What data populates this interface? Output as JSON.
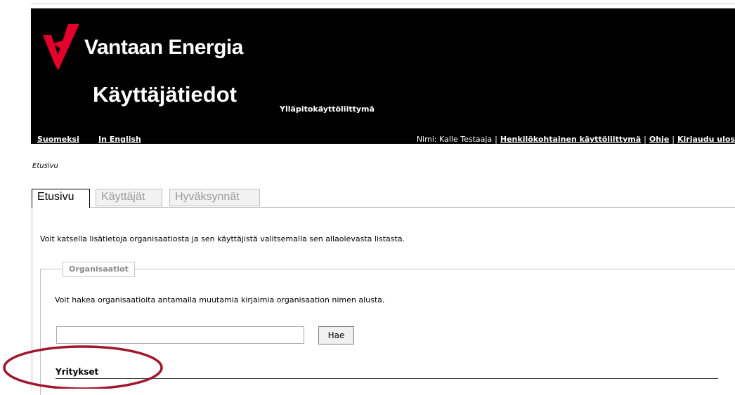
{
  "header": {
    "brand": "Vantaan Energia",
    "app_title": "Käyttäjätiedot",
    "subtitle": "Ylläpitokäyttöliittymä",
    "languages": [
      "Suomeksi",
      "In English"
    ],
    "user": {
      "name_text": "Nimi: Kalle Testaaja",
      "links": [
        "Henkilökohtainen käyttöliittymä",
        "Ohje",
        "Kirjaudu ulos"
      ]
    },
    "logo_color": "#e4002b"
  },
  "breadcrumb": "Etusivu",
  "tabs": [
    {
      "label": "Etusivu",
      "active": true
    },
    {
      "label": "Käyttäjät",
      "active": false
    },
    {
      "label": "Hyväksynnät",
      "active": false
    }
  ],
  "intro_text": "Voit katsella lisätietoja organisaatiosta ja sen käyttäjistä valitsemalla sen allaolevasta listasta.",
  "organizations": {
    "legend": "Organisaatiot",
    "help_text": "Voit hakea organisaatioita antamalla muutamia kirjaimia organisaation nimen alusta.",
    "search_value": "",
    "search_button": "Hae",
    "companies_heading": "Yritykset"
  },
  "annotation_color": "#a0172f"
}
